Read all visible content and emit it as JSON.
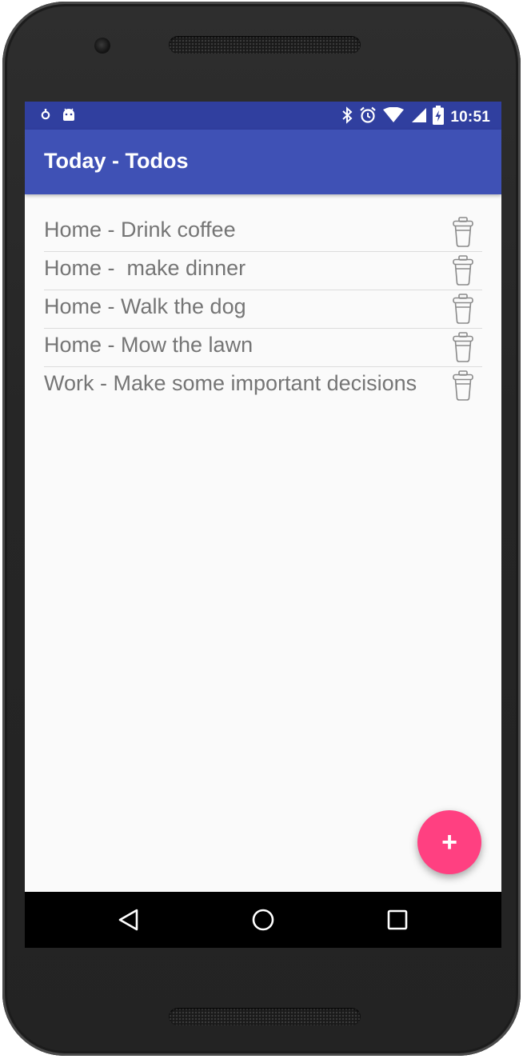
{
  "statusbar": {
    "time": "10:51",
    "left_icons": [
      "notification-dot-icon",
      "android-icon"
    ],
    "right_icons": [
      "bluetooth-icon",
      "alarm-icon",
      "wifi-icon",
      "signal-icon",
      "battery-charging-icon"
    ]
  },
  "appbar": {
    "title": "Today - Todos",
    "color": "#3f51b5",
    "status_color": "#303f9f"
  },
  "todos": [
    {
      "label": "Home - Drink coffee"
    },
    {
      "label": "Home -  make dinner"
    },
    {
      "label": "Home - Walk the dog"
    },
    {
      "label": "Home - Mow the lawn"
    },
    {
      "label": "Work - Make some important decisions"
    }
  ],
  "fab": {
    "label": "+",
    "color": "#ff4081",
    "icon": "add-icon"
  },
  "navbar": {
    "buttons": [
      "back-icon",
      "home-icon",
      "recents-icon"
    ]
  }
}
